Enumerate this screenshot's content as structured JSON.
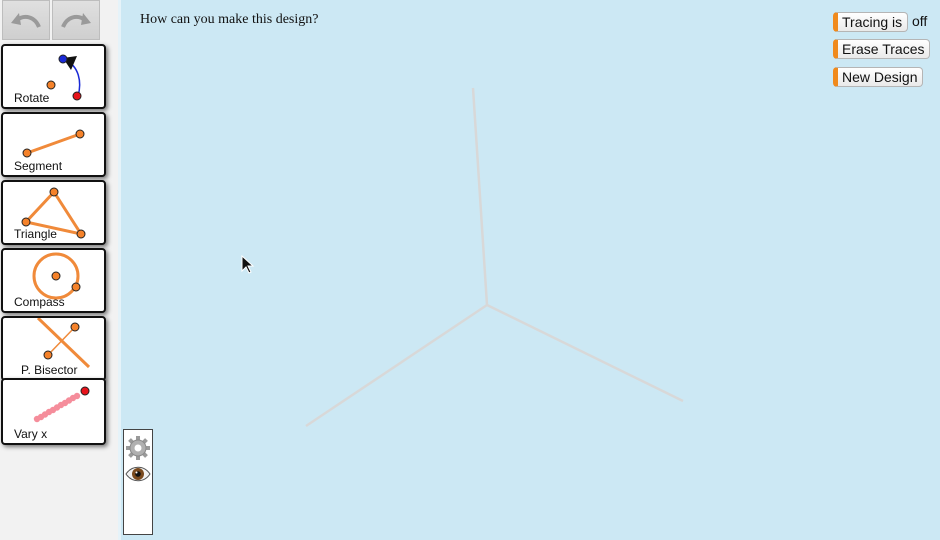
{
  "toolbar": {
    "undo_icon": "undo-arrow-icon",
    "redo_icon": "redo-arrow-icon"
  },
  "tools": [
    {
      "label": "Rotate",
      "icon": "rotate-tool-icon"
    },
    {
      "label": "Segment",
      "icon": "segment-tool-icon"
    },
    {
      "label": "Triangle",
      "icon": "triangle-tool-icon"
    },
    {
      "label": "Compass",
      "icon": "compass-tool-icon"
    },
    {
      "label": "P. Bisector",
      "icon": "perpendicular-bisector-icon"
    },
    {
      "label": "Vary x",
      "icon": "vary-x-icon"
    }
  ],
  "canvas": {
    "prompt": "How can you make this design?",
    "tracing_button": "Tracing is",
    "tracing_state": "off",
    "erase_button": "Erase Traces",
    "new_design_button": "New Design"
  },
  "panel": {
    "icons": [
      "gear-icon",
      "eye-icon"
    ]
  },
  "colors": {
    "canvas_bg": "#cce8f4",
    "accent_orange": "#f08a1c",
    "point_orange": "#f5822a",
    "point_red": "#e8141c",
    "point_blue": "#1a2ad6",
    "design_line": "#d8d8d8"
  }
}
